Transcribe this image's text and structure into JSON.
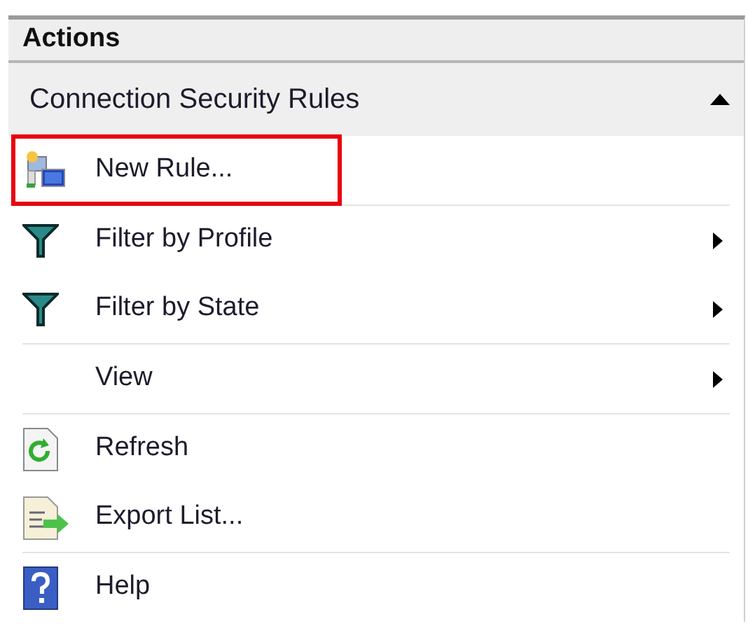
{
  "pane": {
    "title": "Actions"
  },
  "section": {
    "title": "Connection Security Rules",
    "expanded": true
  },
  "groups": [
    {
      "items": [
        {
          "label": "New Rule...",
          "kind": "new-rule",
          "submenu": false,
          "highlighted": true
        }
      ]
    },
    {
      "items": [
        {
          "label": "Filter by Profile",
          "kind": "filter",
          "submenu": true,
          "highlighted": false
        },
        {
          "label": "Filter by State",
          "kind": "filter",
          "submenu": true,
          "highlighted": false
        }
      ]
    },
    {
      "items": [
        {
          "label": "View",
          "kind": "none",
          "submenu": true,
          "highlighted": false
        }
      ]
    },
    {
      "items": [
        {
          "label": "Refresh",
          "kind": "refresh",
          "submenu": false,
          "highlighted": false
        },
        {
          "label": "Export List...",
          "kind": "export",
          "submenu": false,
          "highlighted": false
        }
      ]
    },
    {
      "items": [
        {
          "label": "Help",
          "kind": "help",
          "submenu": false,
          "highlighted": false
        }
      ]
    }
  ]
}
